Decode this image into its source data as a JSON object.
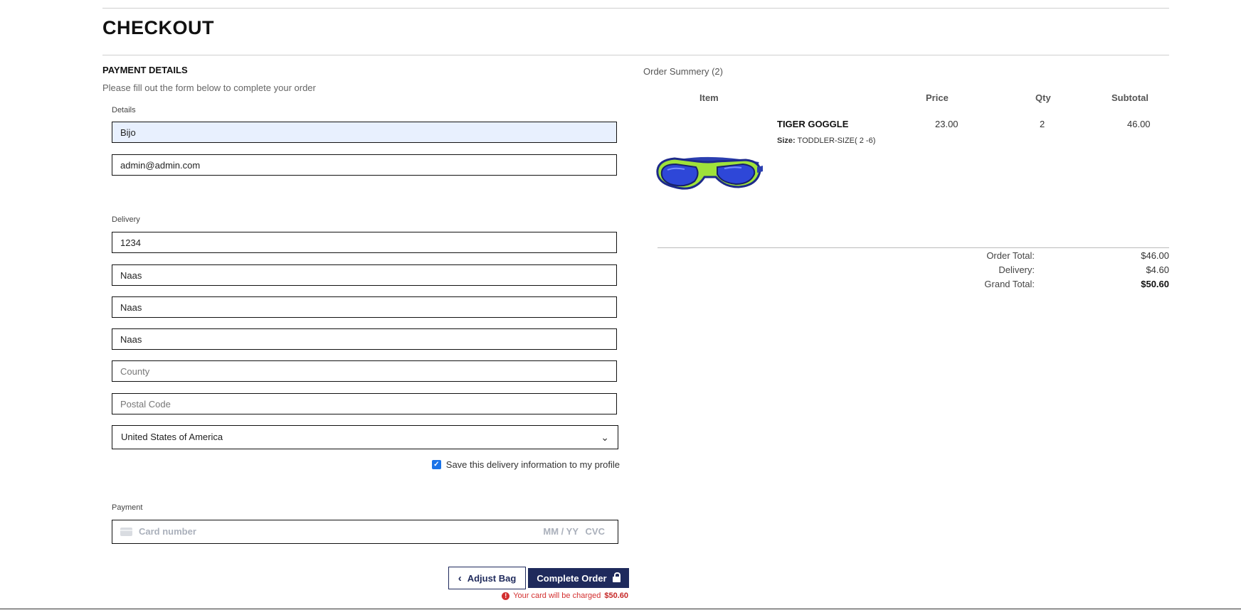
{
  "page": {
    "title": "CHECKOUT"
  },
  "payment": {
    "heading": "PAYMENT DETAILS",
    "subheading": "Please fill out the form below to complete your order",
    "details_label": "Details",
    "name_value": "Bijo",
    "email_value": "admin@admin.com",
    "delivery_label": "Delivery",
    "address1_value": "1234",
    "address2_value": "Naas",
    "address3_value": "Naas",
    "city_value": "Naas",
    "county_placeholder": "County",
    "postal_placeholder": "Postal Code",
    "country_value": "United States of America",
    "save_checked": true,
    "save_label": "Save this delivery information to my profile",
    "payment_label": "Payment",
    "card_placeholder": "Card number",
    "expiry_placeholder": "MM / YY",
    "cvc_placeholder": "CVC"
  },
  "actions": {
    "adjust_label": "Adjust Bag",
    "complete_label": "Complete Order",
    "charge_text": "Your card will be charged",
    "charge_amount": "$50.60"
  },
  "order": {
    "title": "Order Summery (2)",
    "headers": {
      "item": "Item",
      "price": "Price",
      "qty": "Qty",
      "subtotal": "Subtotal"
    },
    "items": [
      {
        "name": "TIGER GOGGLE",
        "size_label": "Size:",
        "size_value": "TODDLER-SIZE( 2 -6)",
        "price": "23.00",
        "qty": "2",
        "subtotal": "46.00",
        "image": "swim-goggles"
      }
    ],
    "totals": {
      "order_total_label": "Order Total:",
      "order_total": "$46.00",
      "delivery_label": "Delivery:",
      "delivery": "$4.60",
      "grand_total_label": "Grand Total:",
      "grand_total": "$50.60"
    }
  },
  "colors": {
    "primary": "#1f2a5c",
    "autofill": "#e8f0fe",
    "error": "#d32f2f",
    "checkbox": "#1a73e8"
  }
}
